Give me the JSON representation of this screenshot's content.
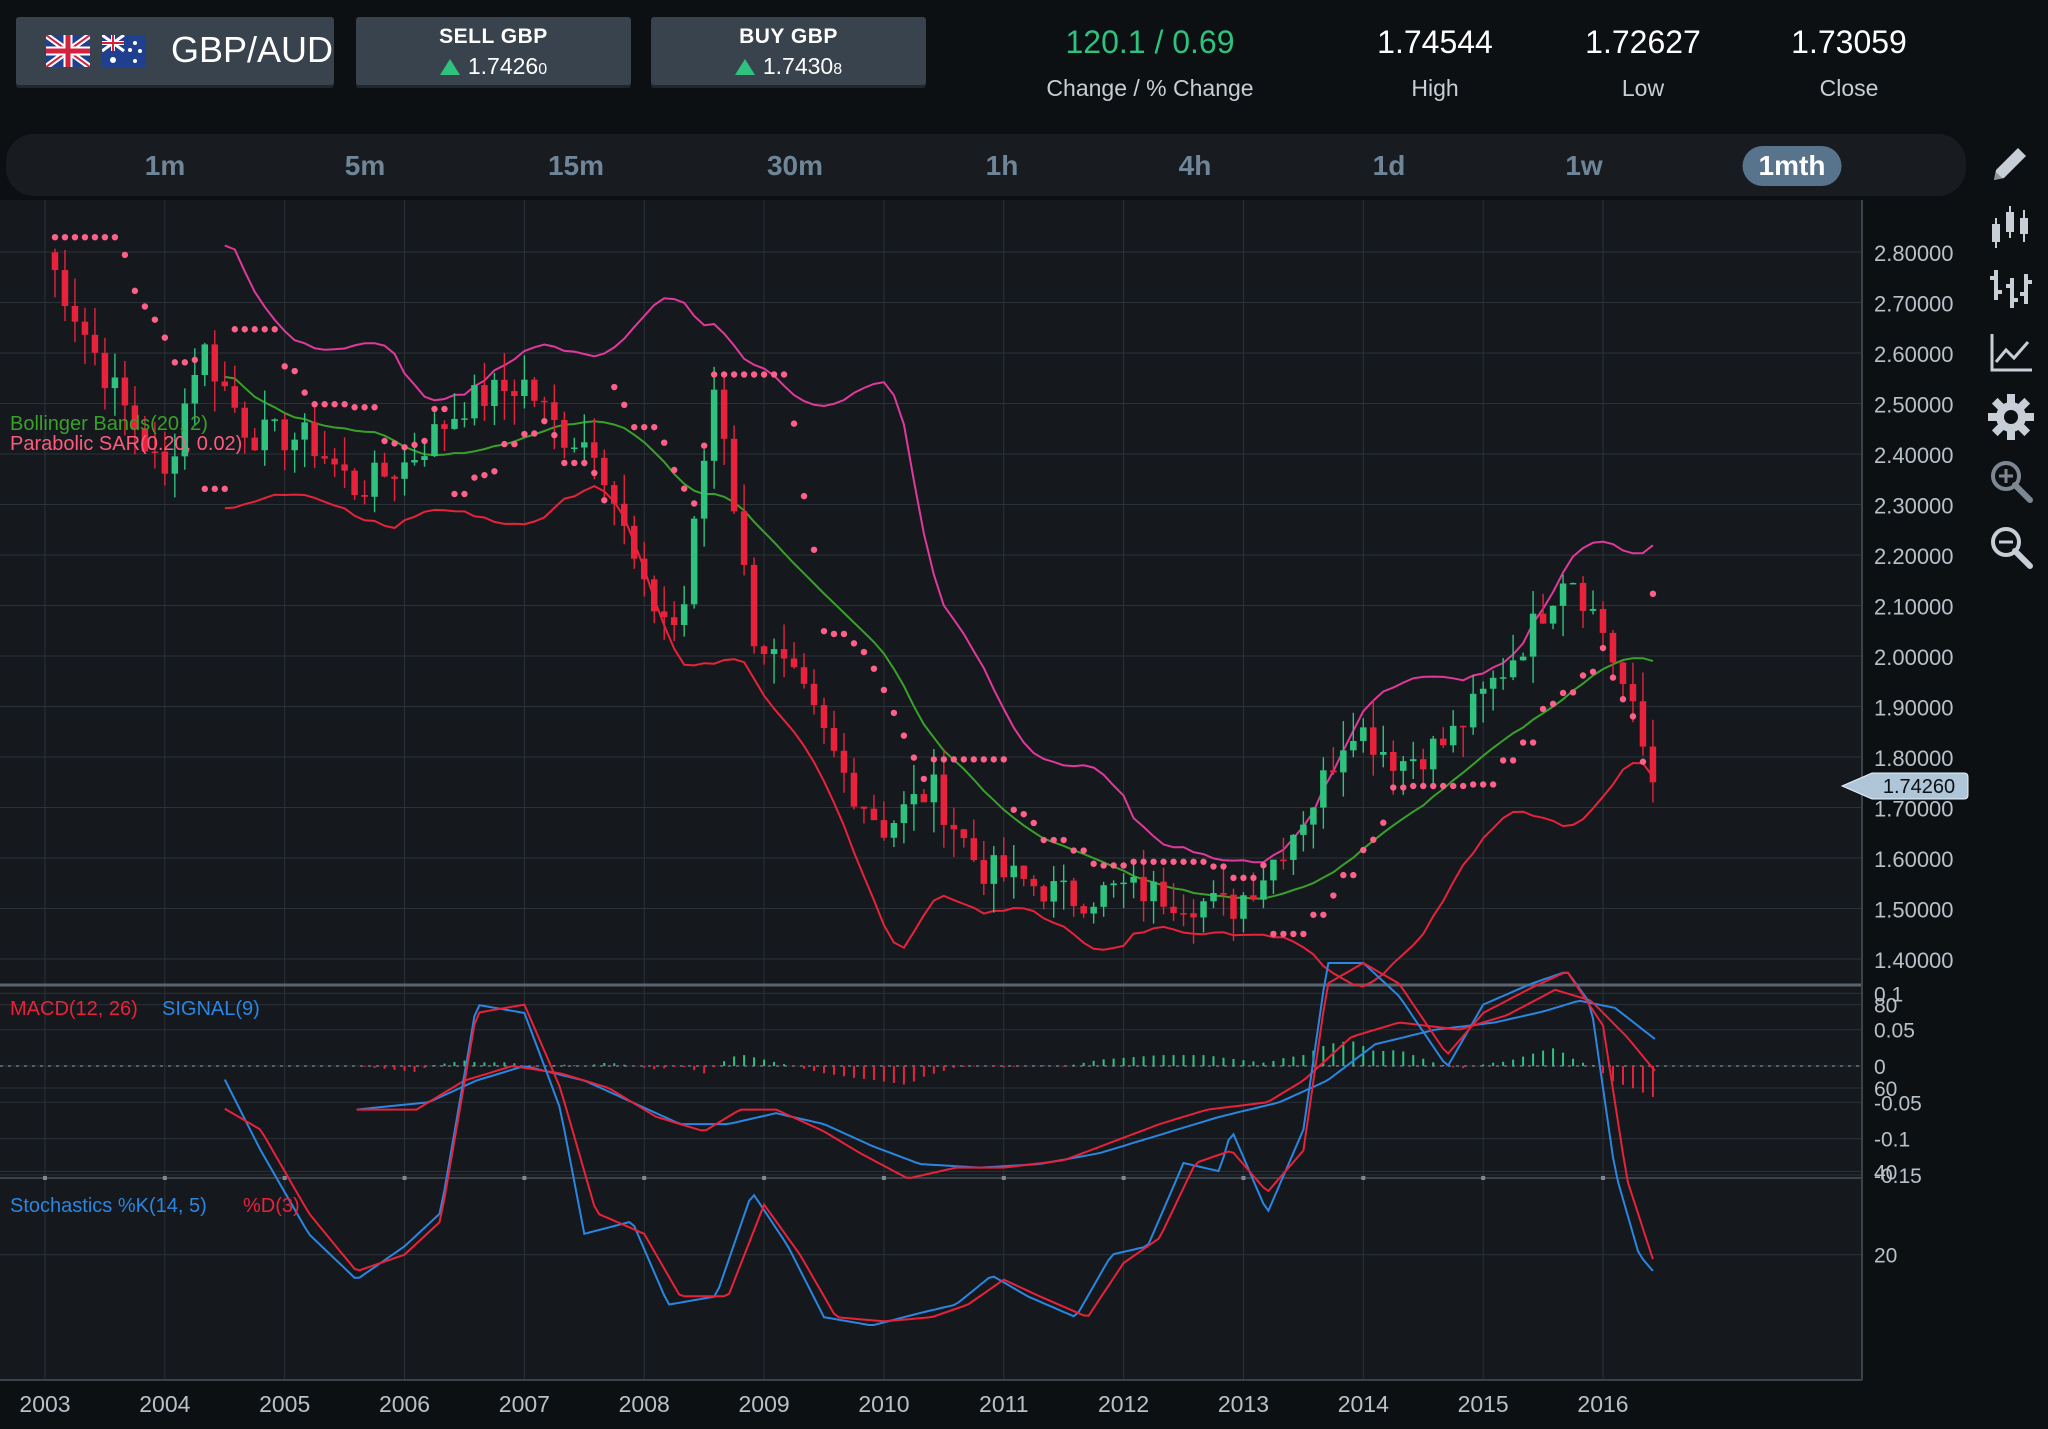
{
  "header": {
    "pair": "GBP/AUD",
    "sell": {
      "label": "SELL GBP",
      "price_main": "1.7426",
      "price_small": "0"
    },
    "buy": {
      "label": "BUY GBP",
      "price_main": "1.7430",
      "price_small": "8"
    },
    "change": {
      "value": "120.1 / 0.69",
      "label": "Change / % Change"
    },
    "high": {
      "value": "1.74544",
      "label": "High"
    },
    "low": {
      "value": "1.72627",
      "label": "Low"
    },
    "close": {
      "value": "1.73059",
      "label": "Close"
    }
  },
  "timeframes": [
    "1m",
    "5m",
    "15m",
    "30m",
    "1h",
    "4h",
    "1d",
    "1w",
    "1mth"
  ],
  "active_timeframe": "1mth",
  "tools": [
    "pencil-icon",
    "candlestick-icon",
    "ohlc-bars-icon",
    "line-chart-icon",
    "gear-icon",
    "zoom-in-icon",
    "zoom-out-icon"
  ],
  "colors": {
    "up": "#2ec27e",
    "down": "#e8223a",
    "upper_band": "#e0389b",
    "middle_band": "#3aa02a",
    "lower_band": "#e8223a",
    "sar": "#ff6088",
    "macd": "#e8223a",
    "signal": "#2a86e0",
    "stoch_k": "#2a86e0",
    "stoch_d": "#e8223a"
  },
  "chart_data": [
    {
      "type": "candlestick",
      "legend": [
        "Bollinger Bands(20, 2)",
        "Parabolic SAR(0.20, 0.02)"
      ],
      "x_ticks": [
        "2003",
        "2004",
        "2005",
        "2006",
        "2007",
        "2008",
        "2009",
        "2010",
        "2011",
        "2012",
        "2013",
        "2014",
        "2015",
        "2016"
      ],
      "y_ticks": [
        "2.80000",
        "2.70000",
        "2.60000",
        "2.50000",
        "2.40000",
        "2.30000",
        "2.20000",
        "2.10000",
        "2.00000",
        "1.90000",
        "1.80000",
        "1.70000",
        "1.60000",
        "1.50000",
        "1.40000"
      ],
      "ylim": [
        1.35,
        2.9
      ],
      "current_price": "1.74260",
      "path_keys": [
        [
          2003.0,
          2.8
        ],
        [
          2003.5,
          2.56
        ],
        [
          2004.0,
          2.35
        ],
        [
          2004.3,
          2.62
        ],
        [
          2004.7,
          2.44
        ],
        [
          2005.2,
          2.43
        ],
        [
          2005.6,
          2.33
        ],
        [
          2006.0,
          2.38
        ],
        [
          2006.5,
          2.5
        ],
        [
          2007.0,
          2.54
        ],
        [
          2007.3,
          2.44
        ],
        [
          2007.6,
          2.42
        ],
        [
          2008.0,
          2.12
        ],
        [
          2008.3,
          2.05
        ],
        [
          2008.6,
          2.56
        ],
        [
          2008.9,
          2.05
        ],
        [
          2009.3,
          1.93
        ],
        [
          2009.7,
          1.75
        ],
        [
          2010.0,
          1.66
        ],
        [
          2010.4,
          1.74
        ],
        [
          2010.8,
          1.58
        ],
        [
          2011.2,
          1.55
        ],
        [
          2011.6,
          1.52
        ],
        [
          2012.0,
          1.54
        ],
        [
          2012.5,
          1.52
        ],
        [
          2012.9,
          1.5
        ],
        [
          2013.2,
          1.58
        ],
        [
          2013.6,
          1.72
        ],
        [
          2013.9,
          1.87
        ],
        [
          2014.3,
          1.79
        ],
        [
          2014.7,
          1.83
        ],
        [
          2015.0,
          1.92
        ],
        [
          2015.4,
          2.05
        ],
        [
          2015.7,
          2.18
        ],
        [
          2016.0,
          2.05
        ],
        [
          2016.2,
          1.92
        ],
        [
          2016.45,
          1.73
        ]
      ]
    },
    {
      "type": "line",
      "legend": [
        "MACD(12, 26)",
        "SIGNAL(9)"
      ],
      "y_ticks": [
        "0.1",
        "0.05",
        "0",
        "-0.05",
        "-0.1",
        "-0.15"
      ],
      "ylim": [
        -0.17,
        0.11
      ],
      "macd_keys": [
        [
          2005.6,
          -0.06
        ],
        [
          2006.1,
          -0.06
        ],
        [
          2006.5,
          -0.02
        ],
        [
          2006.9,
          0.0
        ],
        [
          2007.3,
          -0.01
        ],
        [
          2007.7,
          -0.03
        ],
        [
          2008.1,
          -0.07
        ],
        [
          2008.5,
          -0.09
        ],
        [
          2008.8,
          -0.06
        ],
        [
          2009.1,
          -0.06
        ],
        [
          2009.5,
          -0.09
        ],
        [
          2009.8,
          -0.12
        ],
        [
          2010.2,
          -0.155
        ],
        [
          2010.6,
          -0.14
        ],
        [
          2011.0,
          -0.14
        ],
        [
          2011.5,
          -0.13
        ],
        [
          2011.9,
          -0.105
        ],
        [
          2012.3,
          -0.08
        ],
        [
          2012.7,
          -0.06
        ],
        [
          2013.2,
          -0.05
        ],
        [
          2013.5,
          -0.02
        ],
        [
          2013.9,
          0.04
        ],
        [
          2014.3,
          0.06
        ],
        [
          2014.8,
          0.05
        ],
        [
          2015.2,
          0.07
        ],
        [
          2015.6,
          0.105
        ],
        [
          2015.9,
          0.09
        ],
        [
          2016.2,
          0.04
        ],
        [
          2016.45,
          -0.01
        ]
      ],
      "signal_keys": [
        [
          2005.6,
          -0.06
        ],
        [
          2006.2,
          -0.05
        ],
        [
          2006.6,
          -0.02
        ],
        [
          2007.0,
          0.0
        ],
        [
          2007.5,
          -0.02
        ],
        [
          2007.9,
          -0.05
        ],
        [
          2008.3,
          -0.08
        ],
        [
          2008.7,
          -0.08
        ],
        [
          2009.1,
          -0.065
        ],
        [
          2009.5,
          -0.08
        ],
        [
          2009.9,
          -0.11
        ],
        [
          2010.3,
          -0.135
        ],
        [
          2010.8,
          -0.14
        ],
        [
          2011.3,
          -0.135
        ],
        [
          2011.8,
          -0.12
        ],
        [
          2012.3,
          -0.095
        ],
        [
          2012.8,
          -0.07
        ],
        [
          2013.3,
          -0.05
        ],
        [
          2013.7,
          -0.02
        ],
        [
          2014.1,
          0.03
        ],
        [
          2014.6,
          0.05
        ],
        [
          2015.1,
          0.06
        ],
        [
          2015.5,
          0.075
        ],
        [
          2015.8,
          0.09
        ],
        [
          2016.1,
          0.08
        ],
        [
          2016.45,
          0.035
        ]
      ]
    },
    {
      "type": "line",
      "legend": [
        "Stochastics %K(14, 5)",
        "%D(3)"
      ],
      "y_ticks": [
        "80",
        "60",
        "40",
        "20"
      ],
      "ylim": [
        2,
        92
      ],
      "k_keys": [
        [
          2004.5,
          62
        ],
        [
          2004.8,
          45
        ],
        [
          2005.2,
          25
        ],
        [
          2005.6,
          14
        ],
        [
          2006.0,
          22
        ],
        [
          2006.3,
          30
        ],
        [
          2006.6,
          80
        ],
        [
          2007.0,
          78
        ],
        [
          2007.3,
          55
        ],
        [
          2007.5,
          25
        ],
        [
          2007.9,
          28
        ],
        [
          2008.2,
          8
        ],
        [
          2008.6,
          10
        ],
        [
          2008.9,
          35
        ],
        [
          2009.2,
          22
        ],
        [
          2009.5,
          5
        ],
        [
          2009.9,
          3
        ],
        [
          2010.3,
          6
        ],
        [
          2010.6,
          8
        ],
        [
          2010.9,
          15
        ],
        [
          2011.2,
          10
        ],
        [
          2011.6,
          5
        ],
        [
          2011.9,
          20
        ],
        [
          2012.2,
          22
        ],
        [
          2012.5,
          42
        ],
        [
          2012.8,
          40
        ],
        [
          2012.9,
          50
        ],
        [
          2013.2,
          30
        ],
        [
          2013.5,
          50
        ],
        [
          2013.7,
          90
        ],
        [
          2014.0,
          90
        ],
        [
          2014.3,
          82
        ],
        [
          2014.7,
          65
        ],
        [
          2015.0,
          80
        ],
        [
          2015.4,
          85
        ],
        [
          2015.7,
          88
        ],
        [
          2015.9,
          80
        ],
        [
          2016.1,
          40
        ],
        [
          2016.3,
          20
        ],
        [
          2016.45,
          15
        ]
      ],
      "d_keys": [
        [
          2004.5,
          55
        ],
        [
          2004.8,
          50
        ],
        [
          2005.2,
          30
        ],
        [
          2005.6,
          16
        ],
        [
          2006.0,
          20
        ],
        [
          2006.3,
          28
        ],
        [
          2006.6,
          78
        ],
        [
          2007.0,
          80
        ],
        [
          2007.3,
          60
        ],
        [
          2007.6,
          30
        ],
        [
          2008.0,
          25
        ],
        [
          2008.3,
          10
        ],
        [
          2008.7,
          10
        ],
        [
          2009.0,
          32
        ],
        [
          2009.3,
          20
        ],
        [
          2009.6,
          5
        ],
        [
          2010.0,
          4
        ],
        [
          2010.4,
          5
        ],
        [
          2010.7,
          8
        ],
        [
          2011.0,
          14
        ],
        [
          2011.3,
          10
        ],
        [
          2011.7,
          5
        ],
        [
          2012.0,
          18
        ],
        [
          2012.3,
          24
        ],
        [
          2012.6,
          42
        ],
        [
          2012.9,
          45
        ],
        [
          2013.2,
          35
        ],
        [
          2013.5,
          45
        ],
        [
          2013.7,
          85
        ],
        [
          2014.0,
          90
        ],
        [
          2014.3,
          85
        ],
        [
          2014.7,
          68
        ],
        [
          2015.0,
          78
        ],
        [
          2015.4,
          84
        ],
        [
          2015.7,
          88
        ],
        [
          2016.0,
          75
        ],
        [
          2016.2,
          38
        ],
        [
          2016.45,
          16
        ]
      ]
    }
  ]
}
